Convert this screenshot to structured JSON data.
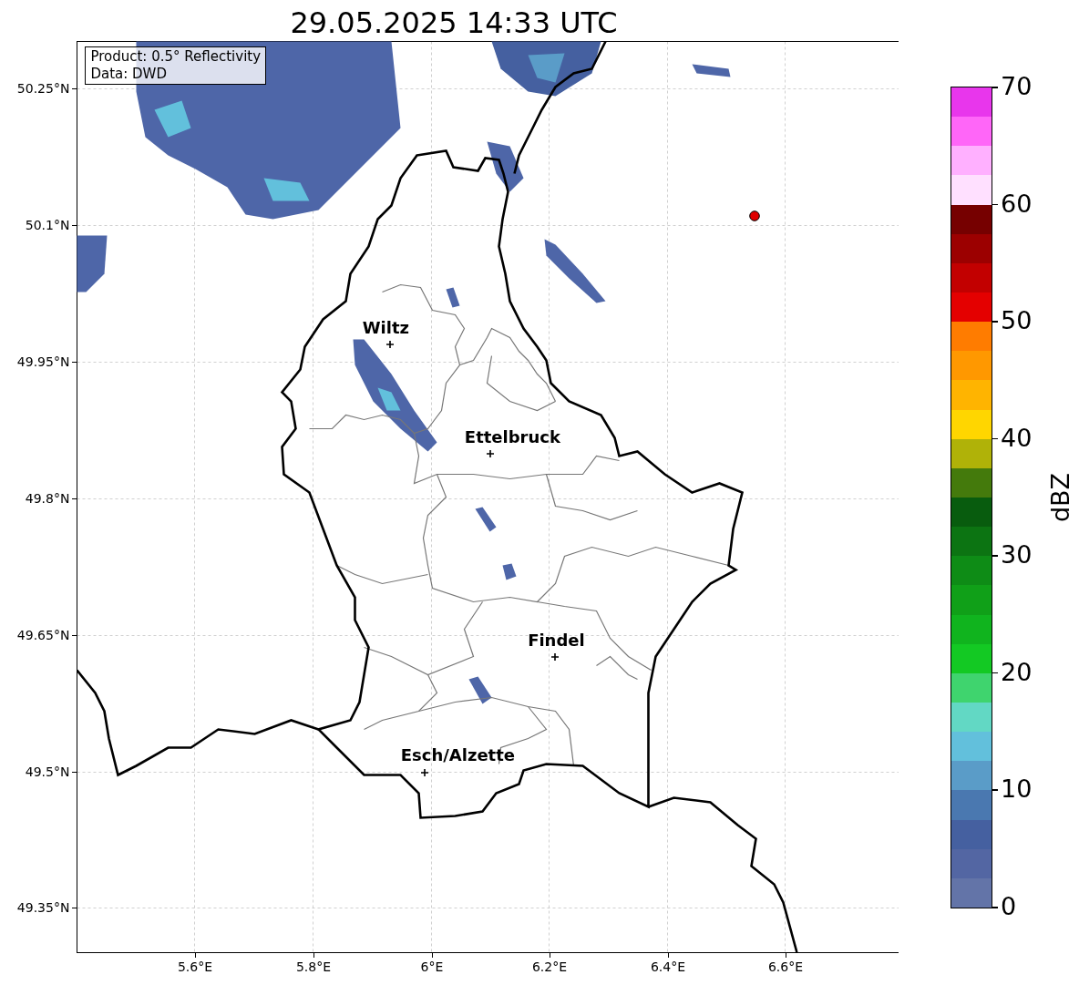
{
  "title": "29.05.2025 14:33 UTC",
  "info_box": {
    "lines": [
      "Product: 0.5° Reflectivity",
      "Data: DWD"
    ]
  },
  "y_ticks": [
    "50.25°N",
    "50.1°N",
    "49.95°N",
    "49.8°N",
    "49.65°N",
    "49.5°N",
    "49.35°N"
  ],
  "x_ticks": [
    "5.6°E",
    "5.8°E",
    "6°E",
    "6.2°E",
    "6.4°E",
    "6.6°E"
  ],
  "cities": [
    {
      "name": "Wiltz"
    },
    {
      "name": "Ettelbruck"
    },
    {
      "name": "Findel"
    },
    {
      "name": "Esch/Alzette"
    }
  ],
  "colorbar": {
    "label": "dBZ",
    "ticks": [
      "70",
      "60",
      "50",
      "40",
      "30",
      "20",
      "10",
      "0"
    ],
    "bands": [
      {
        "color": "#e836ec"
      },
      {
        "color": "#ff66f8"
      },
      {
        "color": "#ffb0ff"
      },
      {
        "color": "#ffe0ff"
      },
      {
        "color": "#760000"
      },
      {
        "color": "#9c0000"
      },
      {
        "color": "#c20000"
      },
      {
        "color": "#e40000"
      },
      {
        "color": "#ff7c00"
      },
      {
        "color": "#ff9800"
      },
      {
        "color": "#ffb400"
      },
      {
        "color": "#ffd600"
      },
      {
        "color": "#b0b208"
      },
      {
        "color": "#447a0c"
      },
      {
        "color": "#085c0e"
      },
      {
        "color": "#0c7412"
      },
      {
        "color": "#0e8c16"
      },
      {
        "color": "#10a018"
      },
      {
        "color": "#10b41e"
      },
      {
        "color": "#13c923"
      },
      {
        "color": "#3fd46e"
      },
      {
        "color": "#62d8c4"
      },
      {
        "color": "#62c0dc"
      },
      {
        "color": "#5a9cc8"
      },
      {
        "color": "#4a78b0"
      },
      {
        "color": "#4560a0"
      },
      {
        "color": "#5366a3"
      },
      {
        "color": "#6374a8"
      }
    ]
  }
}
